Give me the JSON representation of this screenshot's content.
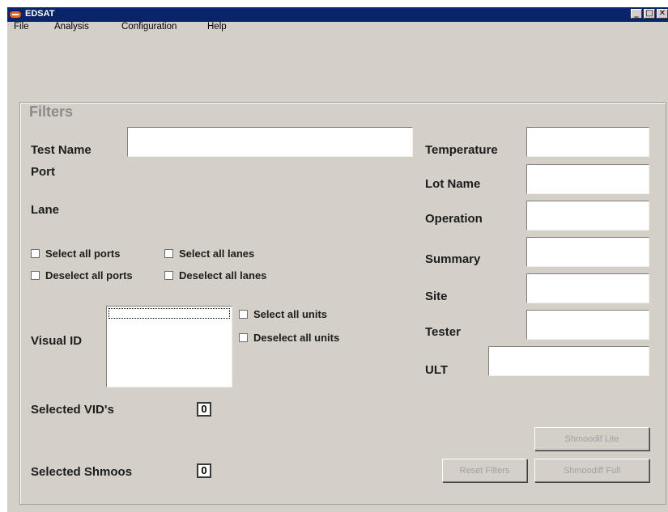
{
  "window": {
    "title": "EDSAT",
    "minimize": "_",
    "maximize": "□",
    "close": "✕"
  },
  "menu": {
    "items": [
      {
        "label": "File"
      },
      {
        "label": "Analysis"
      },
      {
        "label": "Configuration"
      },
      {
        "label": "Help"
      }
    ]
  },
  "filters": {
    "title": "Filters",
    "test_name_label": "Test Name",
    "test_name_value": "",
    "port_label": "Port",
    "lane_label": "Lane",
    "select_all_ports": "Select all ports",
    "deselect_all_ports": "Deselect all ports",
    "select_all_lanes": "Select all lanes",
    "deselect_all_lanes": "Deselect all lanes",
    "visual_id_label": "Visual ID",
    "select_all_units": "Select all units",
    "deselect_all_units": "Deselect all units",
    "selected_vids_label": "Selected VID's",
    "selected_vids_count": "0",
    "selected_shmoos_label": "Selected  Shmoos",
    "selected_shmoos_count": "0",
    "temperature_label": "Temperature",
    "lot_name_label": "Lot Name",
    "operation_label": "Operation",
    "summary_label": "Summary",
    "site_label": "Site",
    "tester_label": "Tester",
    "ult_label": "ULT",
    "temperature_value": "",
    "lot_name_value": "",
    "operation_value": "",
    "summary_value": "",
    "site_value": "",
    "tester_value": "",
    "ult_value": ""
  },
  "buttons": {
    "shmoodif_lite": "Shmoodif Lite",
    "reset_filters": "Reset Filters",
    "shmoodiff_full": "Shmoodiff Full"
  },
  "colors": {
    "titlebar": "#0a246a",
    "window_bg": "#d4d0c8",
    "disabled_text": "#a0a0a0"
  }
}
